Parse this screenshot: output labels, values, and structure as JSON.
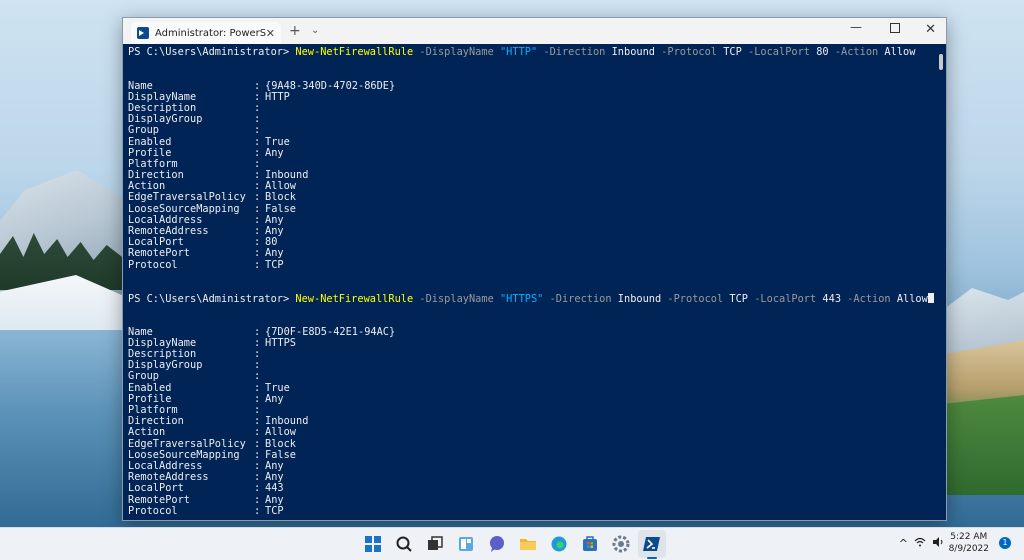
{
  "window": {
    "tab_title": "Administrator: PowerShell",
    "tab_close": "✕",
    "new_tab": "+",
    "dropdown": "⌄",
    "minimize": "—",
    "close": "✕"
  },
  "commands": [
    {
      "prompt": "PS C:\\Users\\Administrator> ",
      "cmdlet": "New-NetFirewallRule",
      "segments": [
        {
          "t": "param",
          "v": " -DisplayName "
        },
        {
          "t": "str",
          "v": "\"HTTP\""
        },
        {
          "t": "param",
          "v": " -Direction "
        },
        {
          "t": "val",
          "v": "Inbound"
        },
        {
          "t": "param",
          "v": " -Protocol "
        },
        {
          "t": "val",
          "v": "TCP"
        },
        {
          "t": "param",
          "v": " -LocalPort "
        },
        {
          "t": "val",
          "v": "80"
        },
        {
          "t": "param",
          "v": " -Action "
        },
        {
          "t": "val",
          "v": "Allow"
        }
      ],
      "cursor": false,
      "properties": [
        {
          "name": "Name",
          "value": "{9A48-340D-4702-86DE}"
        },
        {
          "name": "DisplayName",
          "value": "HTTP"
        },
        {
          "name": "Description",
          "value": ""
        },
        {
          "name": "DisplayGroup",
          "value": ""
        },
        {
          "name": "Group",
          "value": ""
        },
        {
          "name": "Enabled",
          "value": "True"
        },
        {
          "name": "Profile",
          "value": "Any"
        },
        {
          "name": "Platform",
          "value": ""
        },
        {
          "name": "Direction",
          "value": "Inbound"
        },
        {
          "name": "Action",
          "value": "Allow"
        },
        {
          "name": "EdgeTraversalPolicy",
          "value": "Block"
        },
        {
          "name": "LooseSourceMapping",
          "value": "False"
        },
        {
          "name": "LocalAddress",
          "value": "Any"
        },
        {
          "name": "RemoteAddress",
          "value": "Any"
        },
        {
          "name": "LocalPort",
          "value": "80"
        },
        {
          "name": "RemotePort",
          "value": "Any"
        },
        {
          "name": "Protocol",
          "value": "TCP"
        }
      ]
    },
    {
      "prompt": "PS C:\\Users\\Administrator> ",
      "cmdlet": "New-NetFirewallRule",
      "segments": [
        {
          "t": "param",
          "v": " -DisplayName "
        },
        {
          "t": "str",
          "v": "\"HTTPS\""
        },
        {
          "t": "param",
          "v": " -Direction "
        },
        {
          "t": "val",
          "v": "Inbound"
        },
        {
          "t": "param",
          "v": " -Protocol "
        },
        {
          "t": "val",
          "v": "TCP"
        },
        {
          "t": "param",
          "v": " -LocalPort "
        },
        {
          "t": "val",
          "v": "443"
        },
        {
          "t": "param",
          "v": " -Action "
        },
        {
          "t": "val",
          "v": "Allow"
        }
      ],
      "cursor": true,
      "properties": [
        {
          "name": "Name",
          "value": "{7D0F-E8D5-42E1-94AC}"
        },
        {
          "name": "DisplayName",
          "value": "HTTPS"
        },
        {
          "name": "Description",
          "value": ""
        },
        {
          "name": "DisplayGroup",
          "value": ""
        },
        {
          "name": "Group",
          "value": ""
        },
        {
          "name": "Enabled",
          "value": "True"
        },
        {
          "name": "Profile",
          "value": "Any"
        },
        {
          "name": "Platform",
          "value": ""
        },
        {
          "name": "Direction",
          "value": "Inbound"
        },
        {
          "name": "Action",
          "value": "Allow"
        },
        {
          "name": "EdgeTraversalPolicy",
          "value": "Block"
        },
        {
          "name": "LooseSourceMapping",
          "value": "False"
        },
        {
          "name": "LocalAddress",
          "value": "Any"
        },
        {
          "name": "RemoteAddress",
          "value": "Any"
        },
        {
          "name": "LocalPort",
          "value": "443"
        },
        {
          "name": "RemotePort",
          "value": "Any"
        },
        {
          "name": "Protocol",
          "value": "TCP"
        }
      ]
    }
  ],
  "taskbar": {
    "apps": [
      {
        "name": "start-icon",
        "color": "#1a73c8"
      },
      {
        "name": "search-icon",
        "color": "#222222"
      },
      {
        "name": "task-view-icon",
        "color": "#333333"
      },
      {
        "name": "widgets-icon",
        "color": "#2a7bd3"
      },
      {
        "name": "chat-icon",
        "color": "#5b5fc7"
      },
      {
        "name": "file-explorer-icon",
        "color": "#f2b532"
      },
      {
        "name": "edge-icon",
        "color": "#1f9ad6"
      },
      {
        "name": "store-icon",
        "color": "#2d6fb8"
      },
      {
        "name": "settings-icon",
        "color": "#6b7b8c"
      },
      {
        "name": "powershell-icon",
        "color": "#0b4a8c"
      }
    ],
    "tray": {
      "chevron": "^",
      "wifi": "wifi",
      "volume": "🔊"
    },
    "time": "5:22 AM",
    "date": "8/9/2022",
    "notifications": "1"
  }
}
